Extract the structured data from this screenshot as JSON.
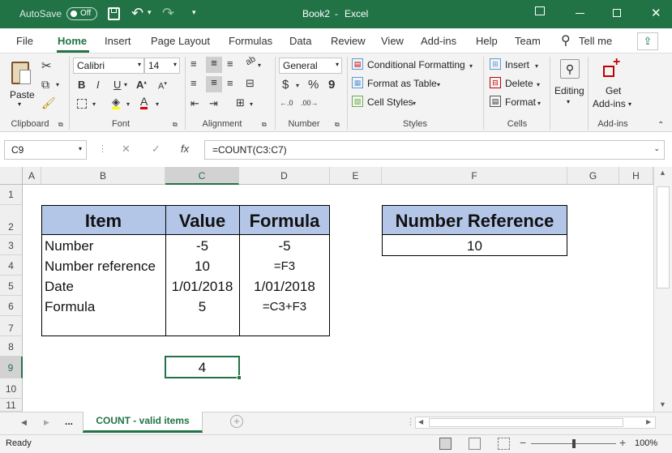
{
  "titlebar": {
    "autosave_label": "AutoSave",
    "autosave_state": "Off",
    "doc_title": "Book2",
    "separator": "-",
    "app_name": "Excel"
  },
  "ribbon_tabs": [
    "File",
    "Home",
    "Insert",
    "Page Layout",
    "Formulas",
    "Data",
    "Review",
    "View",
    "Add-ins",
    "Help",
    "Team"
  ],
  "tell_me": "Tell me",
  "clipboard": {
    "paste": "Paste",
    "group": "Clipboard"
  },
  "font": {
    "name": "Calibri",
    "size": "14",
    "bold": "B",
    "italic": "I",
    "underline": "U",
    "font_color_glyph": "A",
    "group": "Font"
  },
  "alignment": {
    "group": "Alignment",
    "wrap_glyph": "ab"
  },
  "number": {
    "format": "General",
    "currency": "$",
    "percent": "%",
    "comma": "9",
    "group": "Number",
    "inc_dec": "←.0",
    "dec_dec": ".00→"
  },
  "styles": {
    "conditional": "Conditional Formatting",
    "table": "Format as Table",
    "cell": "Cell Styles",
    "group": "Styles"
  },
  "cells": {
    "insert": "Insert",
    "delete": "Delete",
    "format": "Format",
    "group": "Cells"
  },
  "editing": {
    "label": "Editing"
  },
  "addins": {
    "get": "Get",
    "addins": "Add-ins",
    "group": "Add-ins"
  },
  "formula_bar": {
    "name_box": "C9",
    "cancel": "✕",
    "enter": "✓",
    "fx": "fx",
    "formula": "=COUNT(C3:C7)"
  },
  "columns": [
    "A",
    "B",
    "C",
    "D",
    "E",
    "F",
    "G",
    "H"
  ],
  "rows": [
    "1",
    "2",
    "3",
    "4",
    "5",
    "6",
    "7",
    "8",
    "9",
    "10",
    "11"
  ],
  "table": {
    "headers": [
      "Item",
      "Value",
      "Formula"
    ],
    "rows": [
      [
        "Number",
        "-5",
        "-5"
      ],
      [
        "Number reference",
        "10",
        "=F3"
      ],
      [
        "Date",
        "1/01/2018",
        "1/01/2018"
      ],
      [
        "Formula",
        "5",
        "=C3+F3"
      ]
    ]
  },
  "reference": {
    "header": "Number Reference",
    "value": "10"
  },
  "result": "4",
  "sheet": {
    "more": "...",
    "name": "COUNT - valid items"
  },
  "status": {
    "ready": "Ready",
    "zoom": "100%"
  },
  "colors": {
    "excel_green": "#217346",
    "table_header": "#b4c6e7",
    "selection": "#217346"
  }
}
